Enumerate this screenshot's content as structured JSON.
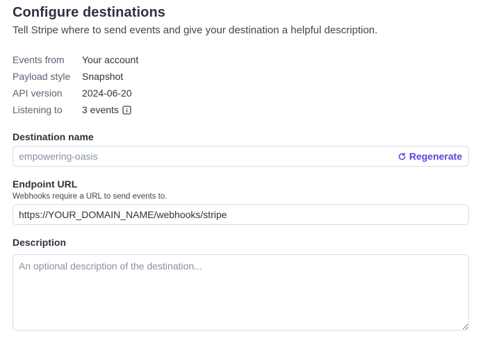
{
  "header": {
    "title": "Configure destinations",
    "subtitle": "Tell Stripe where to send events and give your destination a helpful description."
  },
  "meta": [
    {
      "key": "Events from",
      "value": "Your account"
    },
    {
      "key": "Payload style",
      "value": "Snapshot"
    },
    {
      "key": "API version",
      "value": "2024-06-20"
    },
    {
      "key": "Listening to",
      "value": "3 events"
    }
  ],
  "destination_name": {
    "label": "Destination name",
    "placeholder": "empowering-oasis",
    "regenerate_label": "Regenerate"
  },
  "endpoint_url": {
    "label": "Endpoint URL",
    "hint": "Webhooks require a URL to send events to.",
    "value": "https://YOUR_DOMAIN_NAME/webhooks/stripe"
  },
  "description": {
    "label": "Description",
    "placeholder": "An optional description of the destination..."
  },
  "colors": {
    "accent": "#5b43e0",
    "text": "#30313d",
    "muted": "#596171",
    "border": "#d8dee4"
  }
}
